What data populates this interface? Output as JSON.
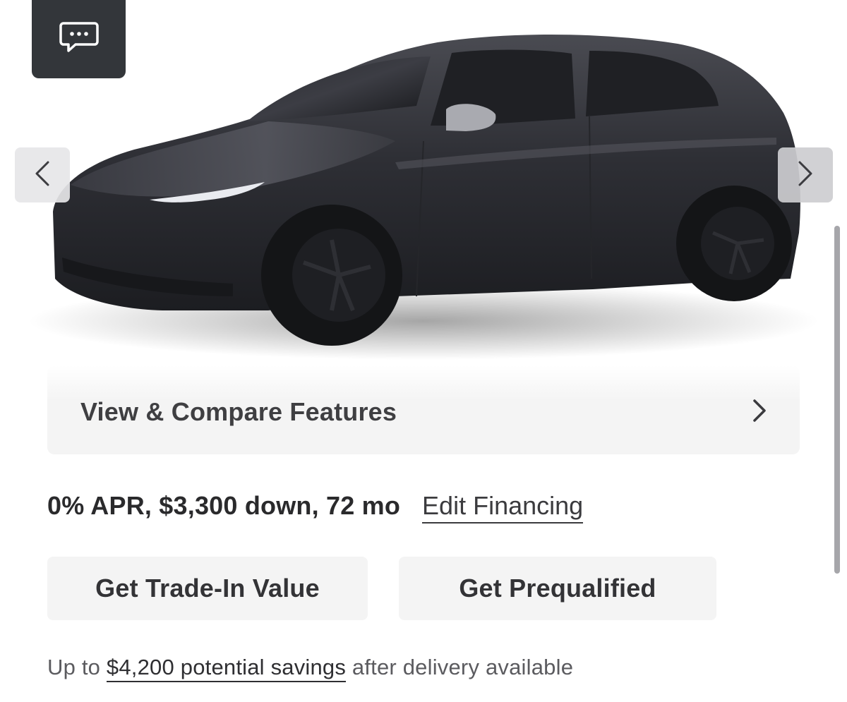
{
  "chat": {
    "icon": "chat-bubble-icon"
  },
  "carousel": {
    "prev_icon": "chevron-left-icon",
    "next_icon": "chevron-right-icon",
    "vehicle_color": "#2b2c31"
  },
  "features": {
    "label": "View & Compare Features",
    "icon": "chevron-right-icon"
  },
  "financing": {
    "terms": "0% APR, $3,300 down, 72 mo",
    "edit_label": "Edit Financing"
  },
  "actions": {
    "trade_in_label": "Get Trade-In Value",
    "prequalify_label": "Get Prequalified"
  },
  "savings": {
    "prefix": "Up to ",
    "link_label": "$4,200 potential savings",
    "suffix": " after delivery available"
  }
}
